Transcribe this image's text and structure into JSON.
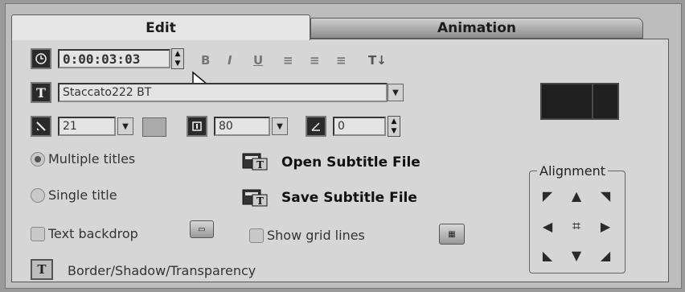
{
  "tabs": {
    "edit": "Edit",
    "animation": "Animation"
  },
  "time": {
    "value": "0:00:03:03"
  },
  "format_buttons": {
    "bold": "B",
    "italic": "I",
    "underline": "U",
    "align_left": "≡",
    "align_center": "≡",
    "align_right": "≡",
    "vertical_text": "T↓"
  },
  "font": {
    "name": "Staccato222 BT",
    "size": "21",
    "line_spacing": "80",
    "angle": "0"
  },
  "options": {
    "multiple_titles": "Multiple titles",
    "single_title": "Single title",
    "text_backdrop": "Text backdrop",
    "show_grid_lines": "Show grid lines",
    "border_shadow": "Border/Shadow/Transparency"
  },
  "subtitle": {
    "open": "Open Subtitle File",
    "save": "Save Subtitle File"
  },
  "alignment": {
    "title": "Alignment"
  },
  "icons": {
    "clock": "clock-icon",
    "text": "T",
    "font_size": "font-size-icon",
    "line_spacing": "line-spacing-icon",
    "angle": "angle-icon"
  }
}
